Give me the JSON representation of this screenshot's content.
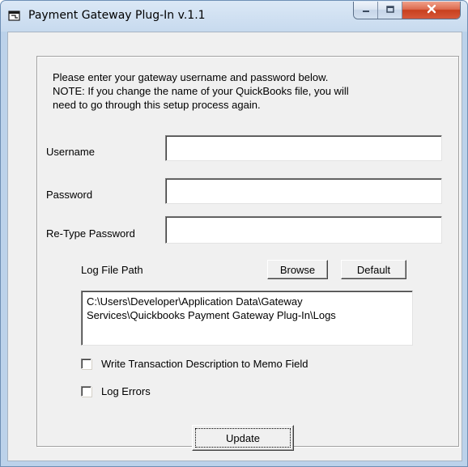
{
  "window": {
    "title": "Payment Gateway Plug-In v.1.1",
    "icon": "app-window-icon",
    "controls": {
      "minimize_icon": "minimize-icon",
      "maximize_icon": "maximize-icon",
      "close_icon": "close-icon"
    }
  },
  "instructions": [
    "Please enter your gateway username and password below.",
    "NOTE:  If you change the name of your QuickBooks file, you will",
    "need to go through this setup process again."
  ],
  "form": {
    "username": {
      "label": "Username",
      "value": ""
    },
    "password": {
      "label": "Password",
      "value": ""
    },
    "retype_password": {
      "label": "Re-Type Password",
      "value": ""
    }
  },
  "log_path": {
    "label": "Log File Path",
    "browse_label": "Browse",
    "default_label": "Default",
    "lines": [
      "C:\\Users\\Developer\\Application Data\\Gateway",
      "Services\\Quickbooks Payment Gateway Plug-In\\Logs"
    ]
  },
  "options": {
    "write_memo": {
      "label": "Write Transaction Description to Memo Field",
      "checked": false
    },
    "log_errors": {
      "label": "Log Errors",
      "checked": false
    }
  },
  "update_label": "Update",
  "colors": {
    "client_bg": "#f0f0f0",
    "frame": "#bcd2ea",
    "close_red": "#c8401e"
  }
}
